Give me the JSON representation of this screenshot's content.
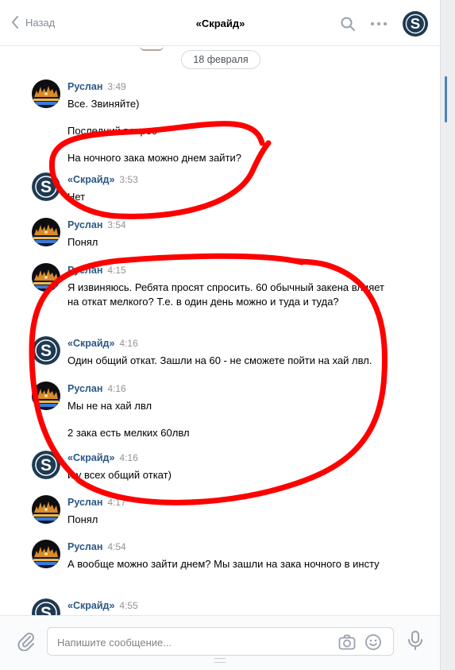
{
  "header": {
    "back_label": "Назад",
    "title": "«Скрайд»"
  },
  "date_separator": "18 февраля",
  "messages": [
    {
      "author": "Руслан",
      "time": "3:49",
      "avatar": "ruslan",
      "texts": [
        "Все. Звиняйте)",
        "Последний вопрос",
        "На ночного зака можно днем зайти?"
      ]
    },
    {
      "author": "«Скрайд»",
      "time": "3:53",
      "avatar": "skraid",
      "texts": [
        "Нет"
      ]
    },
    {
      "author": "Руслан",
      "time": "3:54",
      "avatar": "ruslan",
      "texts": [
        "Понял"
      ]
    },
    {
      "author": "Руслан",
      "time": "4:15",
      "avatar": "ruslan",
      "texts": [
        "Я извиняюсь. Ребята просят спросить. 60 обычный закена влияет на откат мелкого? Т.е. в один день можно и туда и туда?"
      ]
    },
    {
      "author": "«Скрайд»",
      "time": "4:16",
      "avatar": "skraid",
      "texts": [
        "Один общий откат. Зашли на 60 - не сможете пойти на хай лвл."
      ]
    },
    {
      "author": "Руслан",
      "time": "4:16",
      "avatar": "ruslan",
      "texts": [
        "Мы не на хай лвл",
        "2 зака есть мелких 60лвл"
      ]
    },
    {
      "author": "«Скрайд»",
      "time": "4:16",
      "avatar": "skraid",
      "texts": [
        "и у всех общий откат)"
      ]
    },
    {
      "author": "Руслан",
      "time": "4:17",
      "avatar": "ruslan",
      "texts": [
        "Понял"
      ]
    },
    {
      "author": "Руслан",
      "time": "4:54",
      "avatar": "ruslan",
      "texts": [
        "А вообще можно зайти днем? Мы зашли на зака ночного в инсту"
      ]
    },
    {
      "author": "«Скрайд»",
      "time": "4:55",
      "avatar": "skraid",
      "texts": []
    }
  ],
  "composer": {
    "placeholder": "Напишите сообщение..."
  },
  "colors": {
    "accent": "#2a5885",
    "annotation": "#ff0000",
    "avatar_skraid": "#1e3a52"
  },
  "icons": [
    "back-chevron-icon",
    "search-icon",
    "more-icon",
    "attach-icon",
    "camera-icon",
    "smile-icon",
    "microphone-icon"
  ]
}
